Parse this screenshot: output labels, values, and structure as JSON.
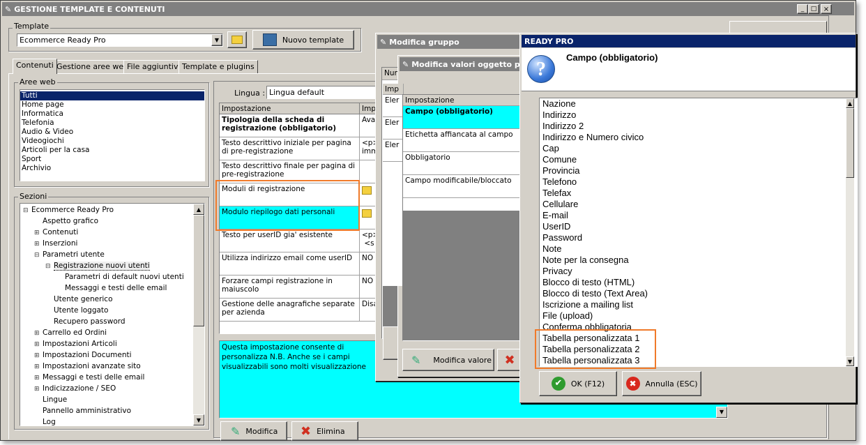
{
  "main_window": {
    "title": "GESTIONE TEMPLATE E CONTENUTI",
    "controls": [
      "_",
      "□",
      "×"
    ]
  },
  "template_group": {
    "label": "Template",
    "selected": "Ecommerce Ready Pro",
    "new_button": "Nuovo template"
  },
  "tabs": [
    "Contenuti",
    "Gestione aree web",
    "File aggiuntivi",
    "Template e plugins"
  ],
  "aree_web": {
    "label": "Aree web",
    "items": [
      "Tutti",
      "Home page",
      "Informatica",
      "Telefonia",
      "Audio & Video",
      "Videogiochi",
      "Articoli per la casa",
      "Sport",
      "Archivio"
    ]
  },
  "sezioni": {
    "label": "Sezioni",
    "items": [
      {
        "t": "Ecommerce Ready Pro",
        "exp": "⊟"
      },
      {
        "t": "Aspetto grafico",
        "exp": ""
      },
      {
        "t": "Contenuti",
        "exp": "⊞"
      },
      {
        "t": "Inserzioni",
        "exp": "⊞"
      },
      {
        "t": "Parametri utente",
        "exp": "⊟"
      },
      {
        "t": "Registrazione nuovi utenti",
        "exp": "⊟"
      },
      {
        "t": "Parametri di default nuovi utenti",
        "exp": ""
      },
      {
        "t": "Messaggi e testi delle email",
        "exp": ""
      },
      {
        "t": "Utente generico",
        "exp": ""
      },
      {
        "t": "Utente loggato",
        "exp": ""
      },
      {
        "t": "Recupero password",
        "exp": ""
      },
      {
        "t": "Carrello ed Ordini",
        "exp": "⊞"
      },
      {
        "t": "Impostazioni Articoli",
        "exp": "⊞"
      },
      {
        "t": "Impostazioni Documenti",
        "exp": "⊞"
      },
      {
        "t": "Impostazioni avanzate sito",
        "exp": "⊞"
      },
      {
        "t": "Messaggi e testi delle email",
        "exp": "⊞"
      },
      {
        "t": "Indicizzazione / SEO",
        "exp": "⊞"
      },
      {
        "t": "Lingue",
        "exp": ""
      },
      {
        "t": "Pannello amministrativo",
        "exp": ""
      },
      {
        "t": "Log",
        "exp": ""
      }
    ]
  },
  "settings": {
    "lingua_label": "Lingua :",
    "lingua_value": "Lingua default",
    "col_impostazione": "Impostazione",
    "col_value": "Imp",
    "rows": [
      {
        "name": "Tipologia della scheda di registrazione (obbligatorio)",
        "value": "Ava"
      },
      {
        "name": "Testo descrittivo iniziale per pagina di pre-registrazione",
        "value": "<p>\nimm"
      },
      {
        "name": "Testo descrittivo finale per pagina di pre-registrazione",
        "value": ""
      },
      {
        "name": "Moduli di registrazione",
        "value": ""
      },
      {
        "name": "Modulo riepilogo dati personali",
        "value": ""
      },
      {
        "name": "Testo per userID gia' esistente",
        "value": "<p>\n <s"
      },
      {
        "name": "Utilizza indirizzo email come userID",
        "value": "NO"
      },
      {
        "name": "Forzare campi registrazione in maiuscolo",
        "value": "NO"
      },
      {
        "name": "Gestione delle anagrafiche separate per azienda",
        "value": "Disa"
      }
    ],
    "description": "Questa impostazione consente di personalizza N.B. Anche se i campi visualizzabili sono molti visualizzazione",
    "modifica_button": "Modifica",
    "elimina_button": "Elimina"
  },
  "modifica_gruppo": {
    "title": "Modifica gruppo",
    "col": "Num",
    "col2": "Imp",
    "rows": [
      "Eler",
      "Eler",
      "Eler"
    ]
  },
  "modifica_valori": {
    "title": "Modifica valori oggetto per",
    "col": "Impostazione",
    "rows": [
      "Campo (obbligatorio)",
      "Etichetta affiancata al campo",
      "Obbligatorio",
      "Campo modificabile/bloccato"
    ],
    "modifica_valore_button": "Modifica valore"
  },
  "ready_pro": {
    "title": "READY PRO",
    "heading": "Campo (obbligatorio)",
    "options": [
      "Nazione",
      "Indirizzo",
      "Indirizzo 2",
      "Indirizzo e Numero civico",
      "Cap",
      "Comune",
      "Provincia",
      "Telefono",
      "Telefax",
      "Cellulare",
      "E-mail",
      "UserID",
      "Password",
      "Note",
      "Note per la consegna",
      "Privacy",
      "Blocco di testo (HTML)",
      "Blocco di testo (Text Area)",
      "Iscrizione a mailing list",
      "File (upload)",
      "Conferma obbligatoria",
      "Tabella personalizzata 1",
      "Tabella personalizzata 2",
      "Tabella personalizzata 3"
    ],
    "ok_button": "OK (F12)",
    "cancel_button": "Annulla (ESC)"
  },
  "colors": {
    "titlebar_gray": "#808080",
    "titlebar_blue": "#0a246a",
    "selection": "#0a246a",
    "cyan": "#00ffff",
    "orange_highlight": "#f07a2a",
    "face": "#d4d0c8"
  }
}
